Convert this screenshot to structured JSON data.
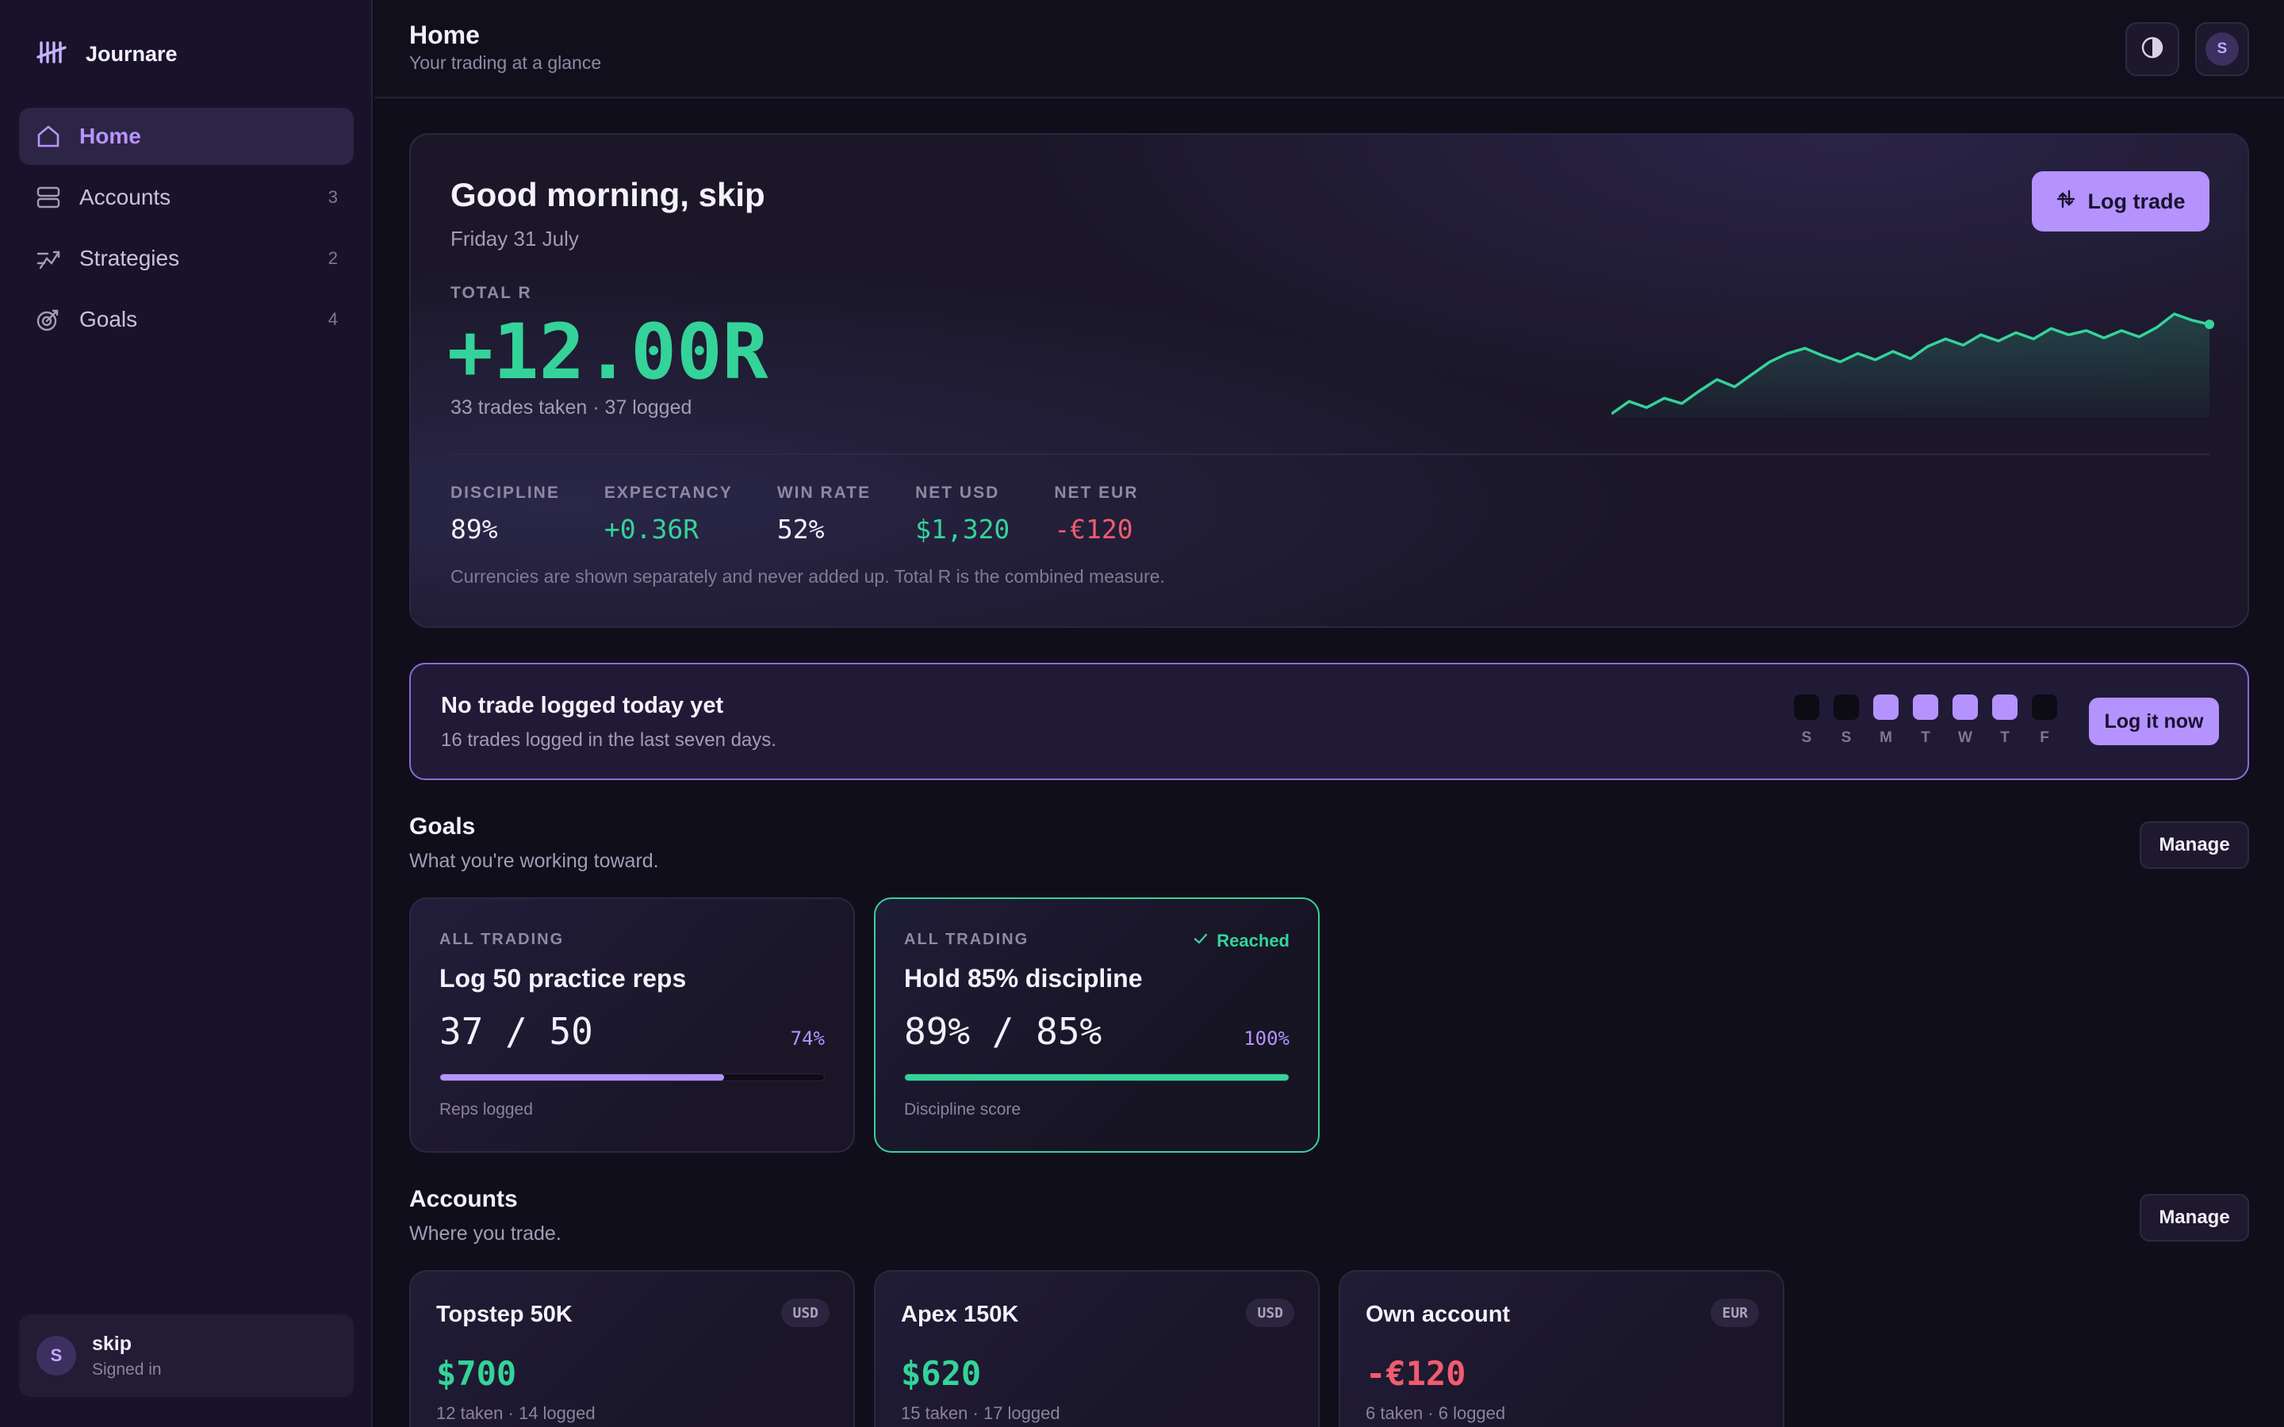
{
  "app": {
    "name": "Journare"
  },
  "sidebar": {
    "items": [
      {
        "label": "Home",
        "count": ""
      },
      {
        "label": "Accounts",
        "count": "3"
      },
      {
        "label": "Strategies",
        "count": "2"
      },
      {
        "label": "Goals",
        "count": "4"
      }
    ],
    "user": {
      "initial": "S",
      "name": "skip",
      "status": "Signed in"
    }
  },
  "header": {
    "title": "Home",
    "subtitle": "Your trading at a glance",
    "avatar_initial": "S"
  },
  "hero": {
    "greeting": "Good morning, skip",
    "date": "Friday 31 July",
    "total_label": "TOTAL R",
    "total_value": "+12.00R",
    "trades_line": "33 trades taken · 37 logged",
    "log_trade_label": "Log trade",
    "stats": [
      {
        "label": "DISCIPLINE",
        "value": "89%",
        "tone": "neutral"
      },
      {
        "label": "EXPECTANCY",
        "value": "+0.36R",
        "tone": "positive"
      },
      {
        "label": "WIN RATE",
        "value": "52%",
        "tone": "neutral"
      },
      {
        "label": "NET USD",
        "value": "$1,320",
        "tone": "positive"
      },
      {
        "label": "NET EUR",
        "value": "-€120",
        "tone": "negative"
      }
    ],
    "currency_note": "Currencies are shown separately and never added up. Total R is the combined measure.",
    "sparkline": {
      "values": [
        0.0,
        1.2,
        0.6,
        1.5,
        1.0,
        2.2,
        3.3,
        2.6,
        3.8,
        5.0,
        5.8,
        6.3,
        5.6,
        5.0,
        5.8,
        5.2,
        6.0,
        5.3,
        6.5,
        7.2,
        6.6,
        7.6,
        7.0,
        7.8,
        7.2,
        8.2,
        7.6,
        8.0,
        7.3,
        8.0,
        7.4,
        8.3,
        9.6,
        9.0,
        8.6
      ],
      "color": "#34d399"
    }
  },
  "reminder": {
    "title": "No trade logged today yet",
    "subtitle": "16 trades logged in the last seven days.",
    "days": [
      {
        "letter": "S",
        "logged": false
      },
      {
        "letter": "S",
        "logged": false
      },
      {
        "letter": "M",
        "logged": true
      },
      {
        "letter": "T",
        "logged": true
      },
      {
        "letter": "W",
        "logged": true
      },
      {
        "letter": "T",
        "logged": true
      },
      {
        "letter": "F",
        "logged": false
      }
    ],
    "button_label": "Log it now"
  },
  "goals": {
    "title": "Goals",
    "subtitle": "What you're working toward.",
    "manage_label": "Manage",
    "cards": [
      {
        "scope": "ALL TRADING",
        "title": "Log 50 practice reps",
        "progress": "37 / 50",
        "percent_label": "74%",
        "fraction": 0.74,
        "caption": "Reps logged",
        "reached": false,
        "reached_label": ""
      },
      {
        "scope": "ALL TRADING",
        "title": "Hold 85% discipline",
        "progress": "89% / 85%",
        "percent_label": "100%",
        "fraction": 1.0,
        "caption": "Discipline score",
        "reached": true,
        "reached_label": "Reached"
      }
    ]
  },
  "accounts": {
    "title": "Accounts",
    "subtitle": "Where you trade.",
    "manage_label": "Manage",
    "cards": [
      {
        "name": "Topstep 50K",
        "currency": "USD",
        "balance": "$700",
        "tone": "positive",
        "meta": "12 taken · 14 logged"
      },
      {
        "name": "Apex 150K",
        "currency": "USD",
        "balance": "$620",
        "tone": "positive",
        "meta": "15 taken · 17 logged"
      },
      {
        "name": "Own account",
        "currency": "EUR",
        "balance": "-€120",
        "tone": "negative",
        "meta": "6 taken · 6 logged"
      }
    ]
  },
  "colors": {
    "accent": "#b493ff",
    "positive": "#34d399",
    "negative": "#f35b6e",
    "background": "#110e1b"
  },
  "icons": {
    "brand": "tally-logo-icon",
    "home": "home-icon",
    "accounts": "database-icon",
    "strategies": "strategy-icon",
    "goals": "target-icon",
    "theme": "contrast-icon",
    "log_trade": "arrows-updown-icon",
    "reached": "check-icon"
  }
}
